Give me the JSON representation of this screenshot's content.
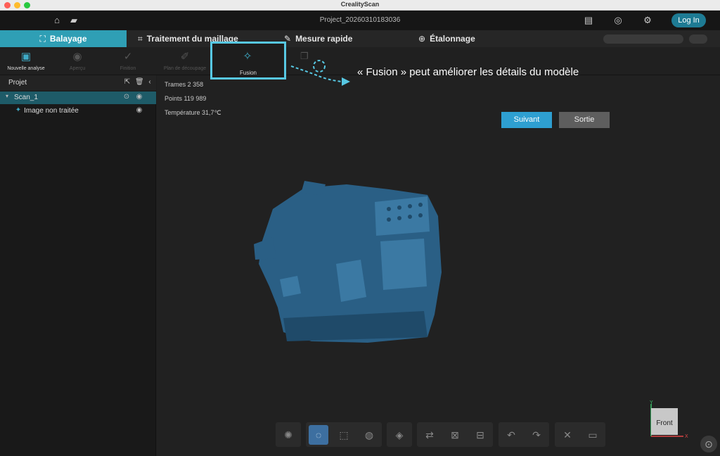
{
  "window": {
    "title": "CrealityScan"
  },
  "appbar": {
    "project_name": "Project_20260310183036",
    "login_label": "Log In",
    "icons": [
      "home-icon",
      "folder-icon",
      "notes-icon",
      "headset-icon",
      "settings-icon"
    ]
  },
  "tabs": [
    {
      "label": "Balayage",
      "icon": "scan-frame-icon",
      "active": true
    },
    {
      "label": "Traitement du maillage",
      "icon": "crop-icon",
      "active": false
    },
    {
      "label": "Mesure rapide",
      "icon": "ruler-icon",
      "active": false
    },
    {
      "label": "Étalonnage",
      "icon": "target-icon",
      "active": false
    }
  ],
  "toolbar": {
    "items": [
      {
        "label": "Nouvelle analyse",
        "icon": "new-file-icon",
        "enabled": true
      },
      {
        "label": "Aperçu",
        "icon": "eye-icon",
        "enabled": false
      },
      {
        "label": "Finition",
        "icon": "check-icon",
        "enabled": false
      },
      {
        "label": "Plan de découpage",
        "icon": "eraser-icon",
        "enabled": false
      },
      {
        "label": "Fusion",
        "icon": "magic-wand-icon",
        "enabled": true
      }
    ]
  },
  "sidebar": {
    "header": "Projet",
    "scan_name": "Scan_1",
    "child_label": "Image non traitée"
  },
  "stats": {
    "frames": "Trames 2 358",
    "points": "Points 119 989",
    "temperature": "Température 31,7℃"
  },
  "tutorial": {
    "hint": "« Fusion » peut améliorer les détails du modèle",
    "next_label": "Suivant",
    "exit_label": "Sortie",
    "accent_color": "#57c8e3"
  },
  "viewcube": {
    "face_label": "Front"
  },
  "colors": {
    "accent": "#2f9fb5",
    "mesh": "#2a5f85",
    "login": "#1e7b94",
    "next": "#2e9fd1"
  }
}
